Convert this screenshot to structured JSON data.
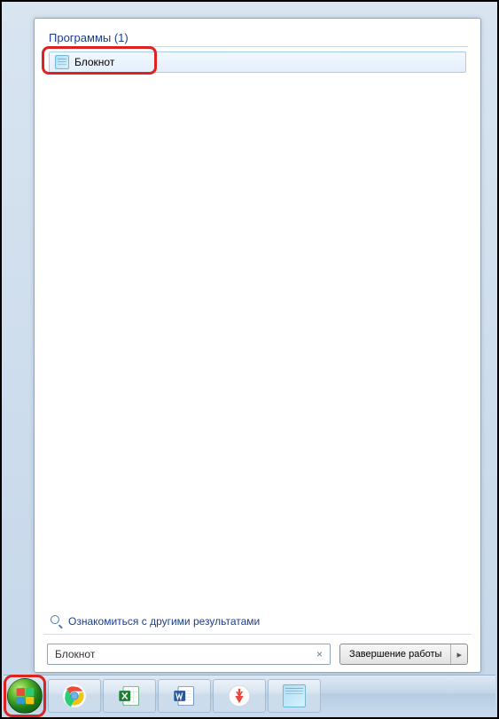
{
  "results": {
    "group_label": "Программы (1)",
    "items": [
      {
        "label": "Блокнот",
        "icon": "notepad-icon"
      }
    ]
  },
  "see_more_label": "Ознакомиться с другими результатами",
  "search": {
    "value": "Блокнот",
    "clear_glyph": "×"
  },
  "shutdown": {
    "label": "Завершение работы",
    "arrow": "▸"
  },
  "taskbar": {
    "items": [
      {
        "name": "chrome",
        "icon": "chrome-icon"
      },
      {
        "name": "excel",
        "icon": "excel-icon"
      },
      {
        "name": "word",
        "icon": "word-icon"
      },
      {
        "name": "yandex",
        "icon": "yandex-icon"
      },
      {
        "name": "notepad",
        "icon": "notepad-icon"
      }
    ]
  },
  "colors": {
    "highlight_border": "#d22",
    "link_blue": "#1a3e8c"
  }
}
